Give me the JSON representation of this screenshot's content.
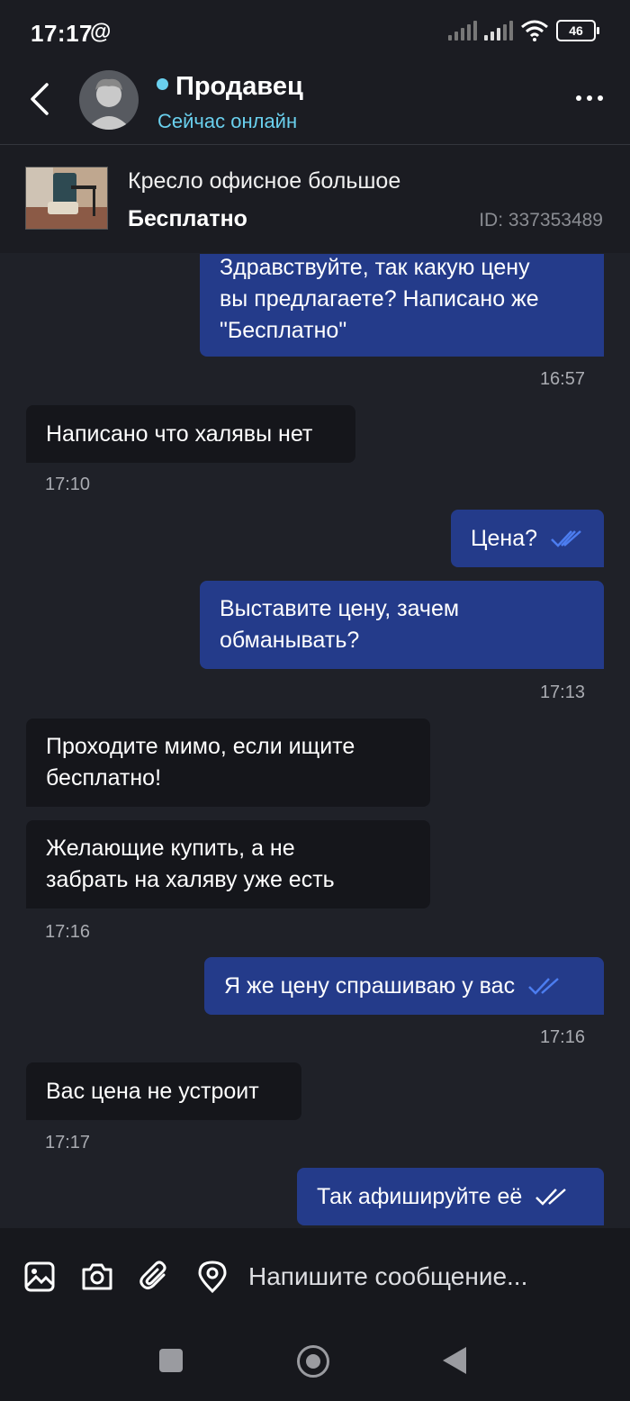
{
  "status_bar": {
    "time": "17:17",
    "at_icon": "@",
    "battery": "46"
  },
  "header": {
    "seller_name": "Продавец",
    "status": "Сейчас онлайн"
  },
  "product": {
    "title": "Кресло офисное большое",
    "price": "Бесплатно",
    "id": "ID: 337353489"
  },
  "messages": [
    {
      "text": "Здравствуйте, так какую цену\nвы предлагаете? Написано же\n\"Бесплатно\"",
      "time": "16:57"
    },
    {
      "text": "Написано что халявы нет",
      "time": "17:10"
    },
    {
      "text": "Цена?"
    },
    {
      "text": "Выставите цену, зачем\nобманывать?",
      "time": "17:13"
    },
    {
      "text": "Проходите мимо, если ищите\nбесплатно!"
    },
    {
      "text": "Желающие купить, а не\nзабрать на халяву уже есть",
      "time": "17:16"
    },
    {
      "text": "Я же цену спрашиваю у вас",
      "time": "17:16"
    },
    {
      "text": "Вас цена не устроит",
      "time": "17:17"
    },
    {
      "text": "Так афишируйте её"
    }
  ],
  "composer": {
    "placeholder": "Напишите сообщение..."
  },
  "colors": {
    "outgoing": "#243b8a",
    "incoming": "#15161b",
    "accent": "#6ad0ee",
    "read_ticks": "#4c7df0"
  }
}
